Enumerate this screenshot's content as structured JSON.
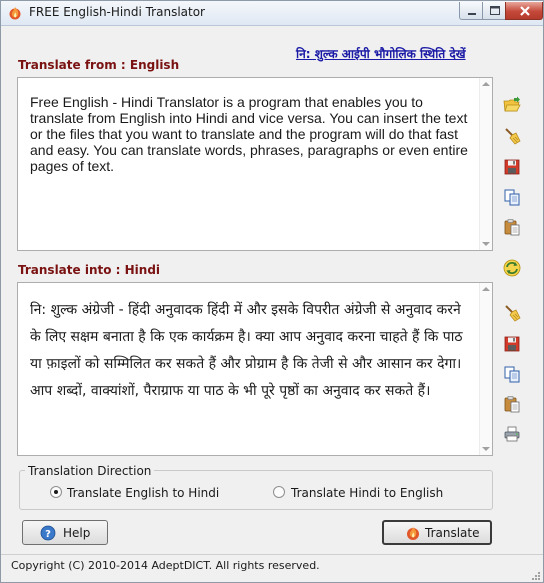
{
  "window": {
    "title": "FREE English-Hindi Translator",
    "controls": [
      "minimize-icon",
      "maximize-icon",
      "close-icon"
    ]
  },
  "top_link": "नि: शुल्क आईपी भौगोलिक स्थिति देखें",
  "source": {
    "label": "Translate from : English",
    "text": "Free English - Hindi Translator is a program that enables you to translate from English into Hindi and vice versa. You can insert the text or the files that you want to translate and the program will do that fast and easy. You can translate words, phrases, paragraphs or even entire pages of text."
  },
  "target": {
    "label": "Translate into : Hindi",
    "text": "नि: शुल्क अंग्रेजी - हिंदी अनुवादक हिंदी में और इसके विपरीत अंग्रेजी से अनुवाद करने के लिए सक्षम बनाता है कि एक कार्यक्रम है। क्या आप अनुवाद करना चाहते हैं कि पाठ या फ़ाइलों को सम्मिलित कर सकते हैं और प्रोग्राम है कि तेजी से और आसान कर देगा। आप शब्दों, वाक्यांशों, पैराग्राफ या पाठ के भी पूरे पृष्ठों का अनुवाद कर सकते हैं।"
  },
  "toolbar_icons": {
    "source": [
      "open-folder-icon",
      "clear-broom-icon",
      "save-disk-icon",
      "copy-icon",
      "paste-icon"
    ],
    "swap": "swap-direction-icon",
    "target": [
      "clear-broom-icon",
      "save-disk-icon",
      "copy-icon",
      "paste-icon",
      "print-icon"
    ]
  },
  "direction": {
    "legend": "Translation Direction",
    "options": [
      {
        "label": "Translate English to Hindi",
        "selected": true
      },
      {
        "label": "Translate Hindi to English",
        "selected": false
      }
    ]
  },
  "buttons": {
    "help": "Help",
    "translate": "Translate"
  },
  "status": "Copyright (C) 2010-2014 AdeptDICT. All rights reserved.",
  "colors": {
    "label_red": "#7a1212",
    "link_blue": "#1a1aa6",
    "close_red": "#c4493a"
  }
}
